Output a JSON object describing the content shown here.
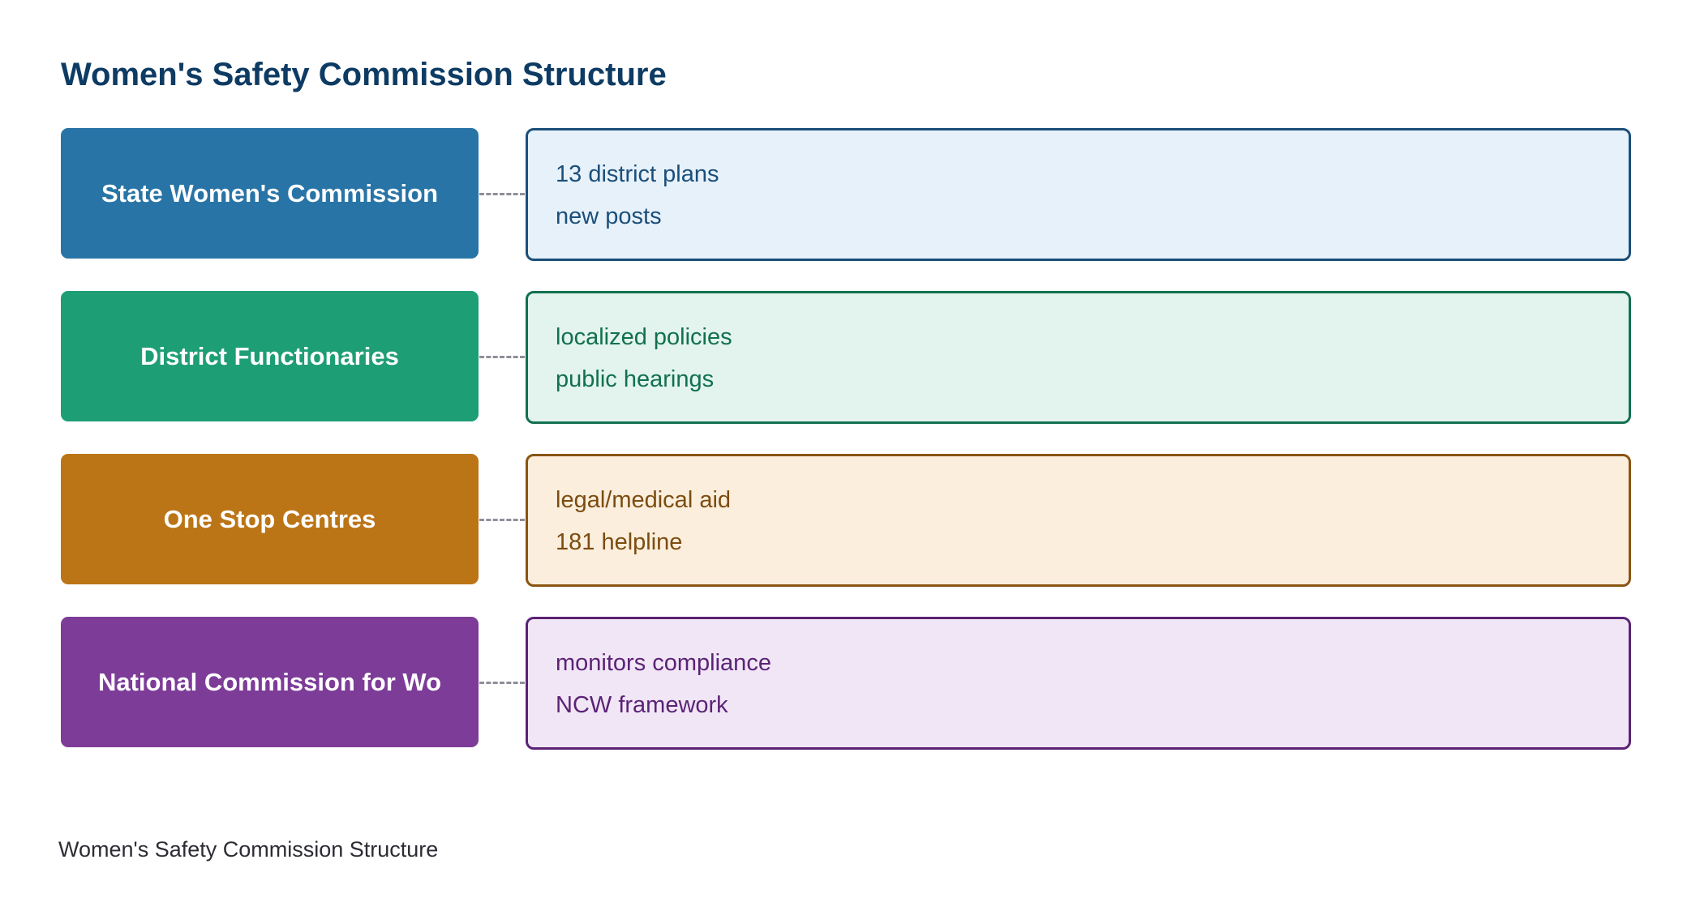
{
  "title": "Women's Safety Commission Structure",
  "caption": "Women's Safety Commission Structure",
  "tiers": [
    {
      "name": "State Women's Commission",
      "details": [
        "13 district plans",
        "new posts"
      ],
      "colors": {
        "fill": "#2874a6",
        "panel_bg": "#e7f1fa",
        "panel_border": "#1b4f7a",
        "panel_text": "#1b4f7a"
      }
    },
    {
      "name": "District Functionaries",
      "details": [
        "localized policies",
        "public hearings"
      ],
      "colors": {
        "fill": "#1e9e74",
        "panel_bg": "#e2f4ed",
        "panel_border": "#12704f",
        "panel_text": "#12704f"
      }
    },
    {
      "name": "One Stop Centres",
      "details": [
        "legal/medical aid",
        "181 helpline"
      ],
      "colors": {
        "fill": "#bb7517",
        "panel_bg": "#fbeedd",
        "panel_border": "#8a5412",
        "panel_text": "#7c4c0f"
      }
    },
    {
      "name": "National Commission for Wo",
      "details": [
        "monitors compliance",
        "NCW framework"
      ],
      "colors": {
        "fill": "#7d3c98",
        "panel_bg": "#f1e6f6",
        "panel_border": "#5b2375",
        "panel_text": "#5b2375"
      }
    }
  ],
  "connector_color": "#8f8f99"
}
